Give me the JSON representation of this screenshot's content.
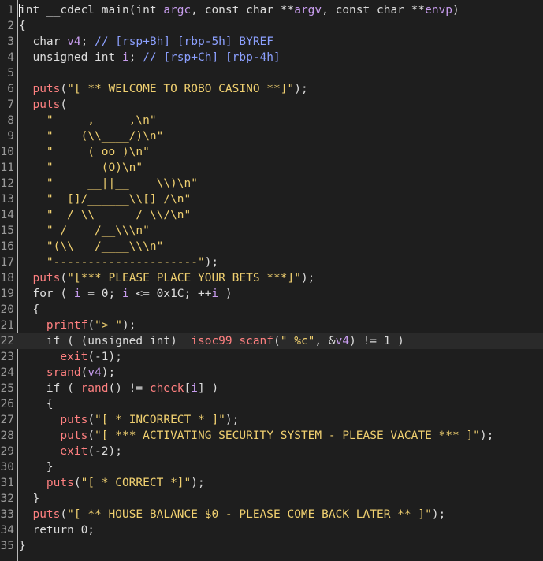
{
  "editor": {
    "current_line": 22,
    "colors": {
      "background": "#1e1e1e",
      "default": "#dcdcdc",
      "function": "#ff8080",
      "string": "#f0d070",
      "variable": "#c79ced",
      "comment": "#8ca0ff",
      "line_number": "#9a9a9a"
    },
    "lines": [
      {
        "n": "1",
        "t": [
          [
            "kw",
            "int __cdecl "
          ],
          [
            "pl",
            "main(int "
          ],
          [
            "var",
            "argc"
          ],
          [
            "pl",
            ", const char **"
          ],
          [
            "var",
            "argv"
          ],
          [
            "pl",
            ", const char **"
          ],
          [
            "var",
            "envp"
          ],
          [
            "pl",
            ")"
          ]
        ]
      },
      {
        "n": "2",
        "t": [
          [
            "pl",
            "{"
          ]
        ]
      },
      {
        "n": "3",
        "t": [
          [
            "kw",
            "  char "
          ],
          [
            "var",
            "v4"
          ],
          [
            "pl",
            "; "
          ],
          [
            "cmt",
            "// [rsp+Bh] [rbp-5h] BYREF"
          ]
        ]
      },
      {
        "n": "4",
        "t": [
          [
            "kw",
            "  unsigned int "
          ],
          [
            "var",
            "i"
          ],
          [
            "pl",
            "; "
          ],
          [
            "cmt",
            "// [rsp+Ch] [rbp-4h]"
          ]
        ]
      },
      {
        "n": "5",
        "t": []
      },
      {
        "n": "6",
        "t": [
          [
            "fn",
            "  puts"
          ],
          [
            "pl",
            "("
          ],
          [
            "str",
            "\"[ ** WELCOME TO ROBO CASINO **]\""
          ],
          [
            "pl",
            ");"
          ]
        ]
      },
      {
        "n": "7",
        "t": [
          [
            "fn",
            "  puts"
          ],
          [
            "pl",
            "("
          ]
        ]
      },
      {
        "n": "8",
        "t": [
          [
            "str",
            "    \"     ,     ,\\n\""
          ]
        ]
      },
      {
        "n": "9",
        "t": [
          [
            "str",
            "    \"    (\\\\____/)\\n\""
          ]
        ]
      },
      {
        "n": "10",
        "t": [
          [
            "str",
            "    \"     (_oo_)\\n\""
          ]
        ]
      },
      {
        "n": "11",
        "t": [
          [
            "str",
            "    \"       (O)\\n\""
          ]
        ]
      },
      {
        "n": "12",
        "t": [
          [
            "str",
            "    \"     __||__    \\\\)\\n\""
          ]
        ]
      },
      {
        "n": "13",
        "t": [
          [
            "str",
            "    \"  []/______\\\\[] /\\n\""
          ]
        ]
      },
      {
        "n": "14",
        "t": [
          [
            "str",
            "    \"  / \\\\______/ \\\\/\\n\""
          ]
        ]
      },
      {
        "n": "15",
        "t": [
          [
            "str",
            "    \" /    /__\\\\\\n\""
          ]
        ]
      },
      {
        "n": "16",
        "t": [
          [
            "str",
            "    \"(\\\\   /____\\\\\\n\""
          ]
        ]
      },
      {
        "n": "17",
        "t": [
          [
            "str",
            "    \"---------------------\""
          ],
          [
            "pl",
            ");"
          ]
        ]
      },
      {
        "n": "18",
        "t": [
          [
            "fn",
            "  puts"
          ],
          [
            "pl",
            "("
          ],
          [
            "str",
            "\"[*** PLEASE PLACE YOUR BETS ***]\""
          ],
          [
            "pl",
            ");"
          ]
        ]
      },
      {
        "n": "19",
        "t": [
          [
            "kw",
            "  for ( "
          ],
          [
            "var",
            "i"
          ],
          [
            "pl",
            " = 0; "
          ],
          [
            "var",
            "i"
          ],
          [
            "pl",
            " <= 0x1C; ++"
          ],
          [
            "var",
            "i"
          ],
          [
            "pl",
            " )"
          ]
        ]
      },
      {
        "n": "20",
        "t": [
          [
            "pl",
            "  {"
          ]
        ]
      },
      {
        "n": "21",
        "t": [
          [
            "fn",
            "    printf"
          ],
          [
            "pl",
            "("
          ],
          [
            "str",
            "\"> \""
          ],
          [
            "pl",
            ");"
          ]
        ]
      },
      {
        "n": "22",
        "t": [
          [
            "kw",
            "    if ( "
          ],
          [
            "pl",
            "(unsigned int)"
          ],
          [
            "fn",
            "__isoc99_scanf"
          ],
          [
            "pl",
            "("
          ],
          [
            "str",
            "\" %c\""
          ],
          [
            "pl",
            ", &"
          ],
          [
            "var",
            "v4"
          ],
          [
            "pl",
            ") != 1 )"
          ]
        ]
      },
      {
        "n": "23",
        "t": [
          [
            "fn",
            "      exit"
          ],
          [
            "pl",
            "(-1);"
          ]
        ]
      },
      {
        "n": "24",
        "t": [
          [
            "fn",
            "    srand"
          ],
          [
            "pl",
            "("
          ],
          [
            "var",
            "v4"
          ],
          [
            "pl",
            ");"
          ]
        ]
      },
      {
        "n": "25",
        "t": [
          [
            "kw",
            "    if ( "
          ],
          [
            "fn",
            "rand"
          ],
          [
            "pl",
            "() != "
          ],
          [
            "fn",
            "check"
          ],
          [
            "pl",
            "["
          ],
          [
            "var",
            "i"
          ],
          [
            "pl",
            "] )"
          ]
        ]
      },
      {
        "n": "26",
        "t": [
          [
            "pl",
            "    {"
          ]
        ]
      },
      {
        "n": "27",
        "t": [
          [
            "fn",
            "      puts"
          ],
          [
            "pl",
            "("
          ],
          [
            "str",
            "\"[ * INCORRECT * ]\""
          ],
          [
            "pl",
            ");"
          ]
        ]
      },
      {
        "n": "28",
        "t": [
          [
            "fn",
            "      puts"
          ],
          [
            "pl",
            "("
          ],
          [
            "str",
            "\"[ *** ACTIVATING SECURITY SYSTEM - PLEASE VACATE *** ]\""
          ],
          [
            "pl",
            ");"
          ]
        ]
      },
      {
        "n": "29",
        "t": [
          [
            "fn",
            "      exit"
          ],
          [
            "pl",
            "(-2);"
          ]
        ]
      },
      {
        "n": "30",
        "t": [
          [
            "pl",
            "    }"
          ]
        ]
      },
      {
        "n": "31",
        "t": [
          [
            "fn",
            "    puts"
          ],
          [
            "pl",
            "("
          ],
          [
            "str",
            "\"[ * CORRECT *]\""
          ],
          [
            "pl",
            ");"
          ]
        ]
      },
      {
        "n": "32",
        "t": [
          [
            "pl",
            "  }"
          ]
        ]
      },
      {
        "n": "33",
        "t": [
          [
            "fn",
            "  puts"
          ],
          [
            "pl",
            "("
          ],
          [
            "str",
            "\"[ ** HOUSE BALANCE $0 - PLEASE COME BACK LATER ** ]\""
          ],
          [
            "pl",
            ");"
          ]
        ]
      },
      {
        "n": "34",
        "t": [
          [
            "kw",
            "  return "
          ],
          [
            "pl",
            "0;"
          ]
        ]
      },
      {
        "n": "35",
        "t": [
          [
            "pl",
            "}"
          ]
        ]
      }
    ]
  }
}
